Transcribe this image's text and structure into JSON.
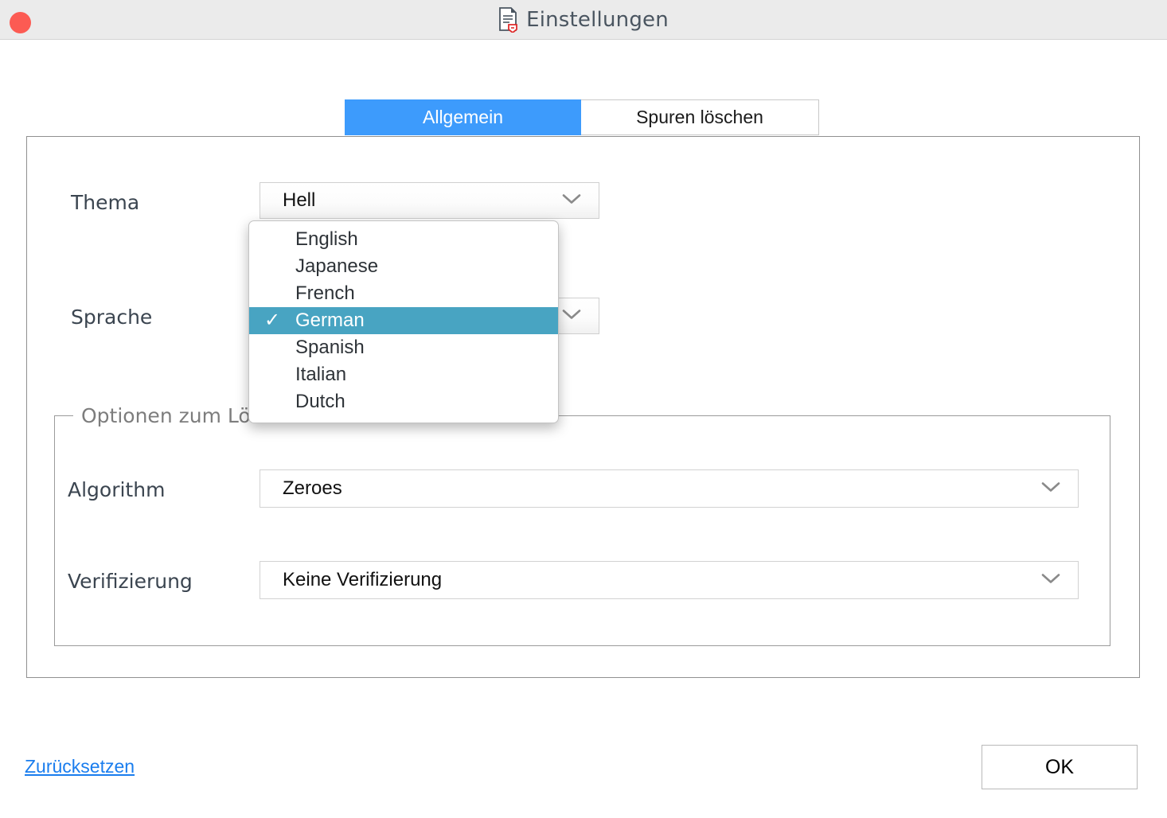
{
  "window": {
    "title": "Einstellungen",
    "title_icon": "document-shield-icon",
    "close_button_color": "#fc5b53",
    "titlebar_bg": "#ebebeb"
  },
  "tabs": [
    {
      "label": "Allgemein",
      "active": true,
      "accent": "#3d9bfc"
    },
    {
      "label": "Spuren löschen",
      "active": false
    }
  ],
  "general": {
    "theme": {
      "label": "Thema",
      "value": "Hell",
      "chevron": "chevron-down-icon"
    },
    "language": {
      "label": "Sprache",
      "value": "",
      "chevron": "chevron-down-icon",
      "menu_open": true,
      "options": [
        {
          "label": "English",
          "selected": false
        },
        {
          "label": "Japanese",
          "selected": false
        },
        {
          "label": "French",
          "selected": false
        },
        {
          "label": "German",
          "selected": true
        },
        {
          "label": "Spanish",
          "selected": false
        },
        {
          "label": "Italian",
          "selected": false
        },
        {
          "label": "Dutch",
          "selected": false
        }
      ],
      "check_glyph": "✓",
      "highlight_color": "#48a4c2"
    }
  },
  "delete_options": {
    "group_label": "Optionen zum Löschen",
    "algorithm": {
      "label": "Algorithm",
      "value": "Zeroes",
      "chevron": "chevron-down-icon"
    },
    "verification": {
      "label": "Verifizierung",
      "value": "Keine Verifizierung",
      "chevron": "chevron-down-icon"
    }
  },
  "footer": {
    "reset_label": "Zurücksetzen",
    "reset_color": "#1a7dee",
    "ok_label": "OK"
  }
}
